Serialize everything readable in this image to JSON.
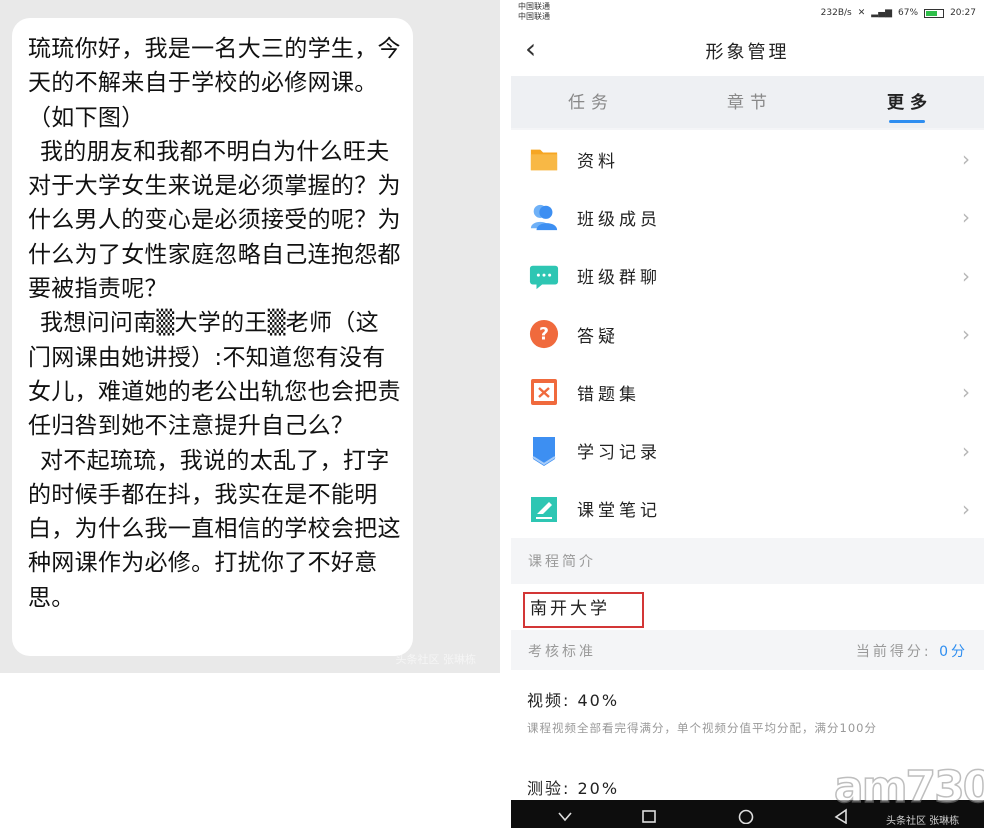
{
  "left": {
    "paragraphs": [
      "琉琉你好，我是一名大三的学生，今天的不解来自于学校的必修网课。（如下图）",
      "我的朋友和我都不明白为什么旺夫对于大学女生来说是必须掌握的？为什么男人的变心是必须接受的呢？为什么为了女性家庭忽略自己连抱怨都要被指责呢？",
      "我想问问南▒大学的王▒老师（这门网课由她讲授）:不知道您有没有女儿，难道她的老公出轨您也会把责任归咎到她不注意提升自己么？",
      "对不起琉琉，我说的太乱了，打字的时候手都在抖，我实在是不能明白，为什么我一直相信的学校会把这种网课作为必修。打扰你了不好意思。"
    ],
    "watermark": "头条社区 张琳栋"
  },
  "right": {
    "status": {
      "carrier1": "中国联通",
      "carrier2": "中国联通",
      "network": "232B/s",
      "battery": "67%",
      "battery_level": 0.67,
      "time": "20:27"
    },
    "nav": {
      "back_icon": "chevron-left-icon",
      "title": "形象管理"
    },
    "tabs": [
      "任务",
      "章节",
      "更多"
    ],
    "active_tab": 2,
    "menu": [
      {
        "label": "资料",
        "icon": "folder-icon",
        "color": "#f6a623"
      },
      {
        "label": "班级成员",
        "icon": "people-icon",
        "color": "#3d8ff2"
      },
      {
        "label": "班级群聊",
        "icon": "chat-icon",
        "color": "#2ec6b3"
      },
      {
        "label": "答疑",
        "icon": "question-icon",
        "color": "#f06a3d"
      },
      {
        "label": "错题集",
        "icon": "wrong-book-icon",
        "color": "#f06a3d"
      },
      {
        "label": "学习记录",
        "icon": "record-icon",
        "color": "#3d8ff2"
      },
      {
        "label": "课堂笔记",
        "icon": "note-icon",
        "color": "#2ec6b3"
      }
    ],
    "intro": {
      "section": "课程简介",
      "school": "南开大学"
    },
    "score": {
      "label": "考核标准",
      "current_label": "当前得分:",
      "current_value": "0分"
    },
    "detail": {
      "video": "视频: 40%",
      "video_desc": "课程视频全部看完得满分，单个视频分值平均分配，满分100分",
      "quiz": "测验: 20%"
    },
    "watermarks": {
      "logo": "am730",
      "weibo": "头条社区 张琳栋"
    }
  }
}
